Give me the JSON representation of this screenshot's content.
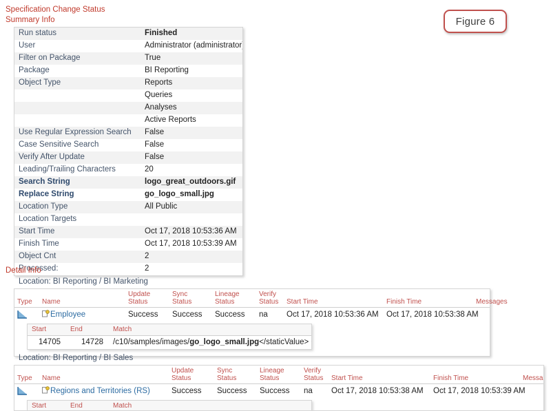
{
  "page": {
    "title": "Specification Change Status",
    "summary_heading": "Summary Info",
    "detail_heading": "Detail Info",
    "figure_label": "Figure 6",
    "accent_red": "#c0392b",
    "label_blue": "#44546a",
    "link_blue": "#2d6ca2",
    "header_red": "#c0504d"
  },
  "summary": {
    "rows": [
      {
        "label": "Run status",
        "value": "Finished",
        "bold_label": false,
        "bold_value": true
      },
      {
        "label": "User",
        "value": "Administrator (administrator)",
        "bold_label": false,
        "bold_value": false
      },
      {
        "label": "Filter on Package",
        "value": "True",
        "bold_label": false,
        "bold_value": false
      },
      {
        "label": "Package",
        "value": "BI Reporting",
        "bold_label": false,
        "bold_value": false
      },
      {
        "label": "Object Type",
        "value": "Reports",
        "bold_label": false,
        "bold_value": false
      },
      {
        "label": "",
        "value": "Queries",
        "bold_label": false,
        "bold_value": false
      },
      {
        "label": "",
        "value": "Analyses",
        "bold_label": false,
        "bold_value": false
      },
      {
        "label": "",
        "value": "Active Reports",
        "bold_label": false,
        "bold_value": false
      },
      {
        "label": "Use Regular Expression Search",
        "value": "False",
        "bold_label": false,
        "bold_value": false
      },
      {
        "label": "Case Sensitive Search",
        "value": "False",
        "bold_label": false,
        "bold_value": false
      },
      {
        "label": "Verify After Update",
        "value": "False",
        "bold_label": false,
        "bold_value": false
      },
      {
        "label": "Leading/Trailing Characters",
        "value": "20",
        "bold_label": false,
        "bold_value": false
      },
      {
        "label": "Search String",
        "value": "logo_great_outdoors.gif",
        "bold_label": true,
        "bold_value": true
      },
      {
        "label": "Replace String",
        "value": "go_logo_small.jpg",
        "bold_label": true,
        "bold_value": true
      },
      {
        "label": "Location Type",
        "value": "All Public",
        "bold_label": false,
        "bold_value": false
      },
      {
        "label": "Location Targets",
        "value": "",
        "bold_label": false,
        "bold_value": false
      },
      {
        "label": "Start Time",
        "value": "Oct 17, 2018 10:53:36 AM",
        "bold_label": false,
        "bold_value": false
      },
      {
        "label": "Finish Time",
        "value": "Oct 17, 2018 10:53:39 AM",
        "bold_label": false,
        "bold_value": false
      },
      {
        "label": "Object Cnt",
        "value": "2",
        "bold_label": false,
        "bold_value": false
      },
      {
        "label": "Processed:",
        "value": "2",
        "bold_label": false,
        "bold_value": false
      }
    ]
  },
  "detail": {
    "columns": [
      {
        "line1": "Type",
        "line2": ""
      },
      {
        "line1": "Name",
        "line2": ""
      },
      {
        "line1": "Update",
        "line2": "Status"
      },
      {
        "line1": "Sync",
        "line2": "Status"
      },
      {
        "line1": "Lineage",
        "line2": "Status"
      },
      {
        "line1": "Verify",
        "line2": "Status"
      },
      {
        "line1": "",
        "line2": "Start Time"
      },
      {
        "line1": "",
        "line2": "Finish Time"
      },
      {
        "line1": "",
        "line2": "Messages"
      }
    ],
    "match_columns": [
      "Start",
      "End",
      "Match"
    ],
    "sections": [
      {
        "location": "Location: BI Reporting / BI Marketing",
        "type_icon": "report-icon",
        "object_icon": "object-badge-icon",
        "name": "Employee",
        "update_status": "Success",
        "sync_status": "Success",
        "lineage_status": "Success",
        "verify_status": "na",
        "start_time": "Oct 17, 2018 10:53:36 AM",
        "finish_time": "Oct 17, 2018 10:53:38 AM",
        "messages": "",
        "matches": [
          {
            "start": "14705",
            "end": "14728",
            "prefix": "/c10/samples/images/",
            "bold": "go_logo_small.jpg",
            "suffix": "</staticValue> </"
          }
        ]
      },
      {
        "location": "Location: BI Reporting / BI Sales",
        "type_icon": "report-icon",
        "object_icon": "object-badge-icon",
        "name": "Regions and Territories (RS)",
        "update_status": "Success",
        "sync_status": "Success",
        "lineage_status": "Success",
        "verify_status": "na",
        "start_time": "Oct 17, 2018 10:53:38 AM",
        "finish_time": "Oct 17, 2018 10:53:39 AM",
        "messages": "",
        "matches": []
      }
    ]
  }
}
